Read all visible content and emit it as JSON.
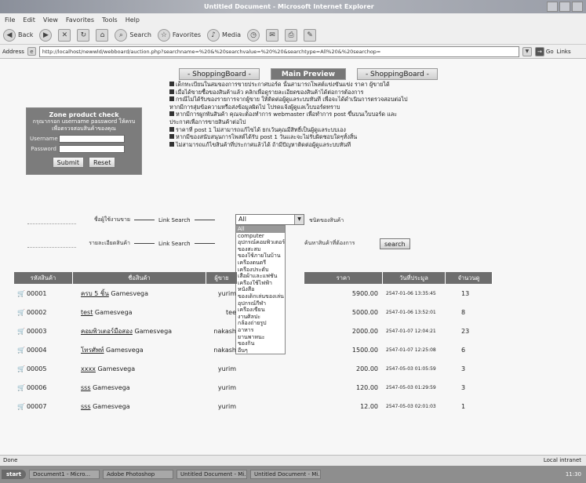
{
  "window": {
    "title": "Untitled Document - Microsoft Internet Explorer"
  },
  "menu": [
    "File",
    "Edit",
    "View",
    "Favorites",
    "Tools",
    "Help"
  ],
  "toolbar": {
    "back": "Back",
    "search": "Search",
    "favorites": "Favorites",
    "media": "Media"
  },
  "address": {
    "label": "Address",
    "url": "http://localhost/newwld/webboard/auction.php?searchname=%20&%20searchvalue=%20%20&searchtype=All%20&%20searchop=",
    "go": "Go",
    "links": "Links"
  },
  "tabs": [
    "- ShoppingBoard -",
    "Main Preview",
    "- ShoppingBoard -"
  ],
  "notice": [
    "เด็กทะเบียนในสมของการขายประกาศบอร์ด นั้นสามารถโพสต์แข่งขันแข่ง ราคา ผู้ขายได้",
    "เมื่อได้ขายซื้อของสินค้าแล้ว คลิกเพื่อดูรายละเอียดของสินค้าได้ต่อการต้องการ",
    "กรณีไม่ได้รับของรายการจากผู้ขาย ให้ติดต่อผู้ดูแลระบบทันที เพื่อจะได้ดำเนินการตรวจสอบต่อไป",
    "หากมีการสุ่มข้อความหรือส่งข้อมูลผิดไป โปรดแจ้งผู้ดูแลเว็บบอร์ดทราบ",
    "หากมีการผูกพันสินค้า คุณจะต้องทำการ webmaster เพื่อทำการ post ขึ้นบนเว็บบอร์ด และ",
    "ประกาศเพื่อการขายสินค้าต่อไป",
    "ราคาที่ post 1 ไม่สามารถแก้ไขได้ ยกเว้นคุณมีสิทธิ์เป็นผู้ดูแลระบบเอง",
    "หากมีของสนับสนุนการโพสต์ได้รับ post 1 วันและจะไม่รับผิดชอบใดๆทั้งสิ้น",
    "ไม่สามารถแก้ไขสินค้าที่ประกาศแล้วได้ ถ้ามีปัญหาติดต่อผู้ดูแลระบบทันที"
  ],
  "login": {
    "title": "Zone product check",
    "desc": "กรุณากรอก username password ให้ครบ เพื่อตรวจสอบสินค้าของคุณ",
    "user_label": "Username",
    "pass_label": "Password",
    "submit": "Submit",
    "reset": "Reset"
  },
  "search": {
    "row1_label": "ชื่อผู้ใช้งานขาย",
    "row1_link": "Link Search",
    "row2_label": "รายละเอียดสินค้า",
    "row2_link": "Link Search",
    "select_value": "All",
    "type_label": "ชนิดของสินค้า",
    "hint": "ค้นหาสินค้าที่ต้องการ",
    "button": "search",
    "options": [
      "All",
      "computer",
      "อุปกรณ์คอมพิวเตอร์",
      "ของสะสม",
      "ของใช้ภายในบ้าน",
      "เครื่องดนตรี",
      "เครื่องประดับ",
      "เสื้อผ้าและแฟชั่น",
      "เครื่องใช้ไฟฟ้า",
      "หนังสือ",
      "ของเด็กเล่นของเล่น",
      "อุปกรณ์กีฬา",
      "เครื่องเขียน",
      "งานศิลปะ",
      "กล้องถ่ายรูป",
      "อาหาร",
      "ยานพาหนะ",
      "ของกิน",
      "อื่นๆ"
    ]
  },
  "table": {
    "headers": [
      "รหัสสินค้า",
      "ชื่อสินค้า",
      "ผู้ขาย",
      "ราคา",
      "วันที่ประมูล",
      "จำนวนดู"
    ],
    "rows": [
      {
        "id": "00001",
        "name": "ครบ 5 ชิ้น",
        "suffix": "Gamesvega",
        "owner": "yurim",
        "price": "5900.00",
        "date": "2547-01-06 13:35:45",
        "views": "13"
      },
      {
        "id": "00002",
        "name": "test",
        "suffix": "Gamesvega",
        "owner": "tee",
        "price": "5000.00",
        "date": "2547-01-06 13:52:01",
        "views": "8"
      },
      {
        "id": "00003",
        "name": "คอมพิวเตอร์มือสอง",
        "suffix": "Gamesvega",
        "owner": "nakash",
        "price": "2000.00",
        "date": "2547-01-07 12:04:21",
        "views": "23"
      },
      {
        "id": "00004",
        "name": "โทรศัพท์",
        "suffix": "Gamesvega",
        "owner": "nakash",
        "price": "1500.00",
        "date": "2547-01-07 12:25:08",
        "views": "6"
      },
      {
        "id": "00005",
        "name": "xxxx",
        "suffix": "Gamesvega",
        "owner": "yurim",
        "price": "200.00",
        "date": "2547-05-03 01:05:59",
        "views": "3"
      },
      {
        "id": "00006",
        "name": "sss",
        "suffix": "Gamesvega",
        "owner": "yurim",
        "price": "120.00",
        "date": "2547-05-03 01:29:59",
        "views": "3"
      },
      {
        "id": "00007",
        "name": "sss",
        "suffix": "Gamesvega",
        "owner": "yurim",
        "price": "12.00",
        "date": "2547-05-03 02:01:03",
        "views": "1"
      }
    ]
  },
  "status": {
    "left": "Done",
    "zone": "Local intranet"
  },
  "taskbar": {
    "start": "start",
    "tasks": [
      "Document1 - Micro...",
      "Adobe Photoshop",
      "Untitled Document - Mi...",
      "Untitled Document - Mi..."
    ],
    "clock": "11:30"
  }
}
